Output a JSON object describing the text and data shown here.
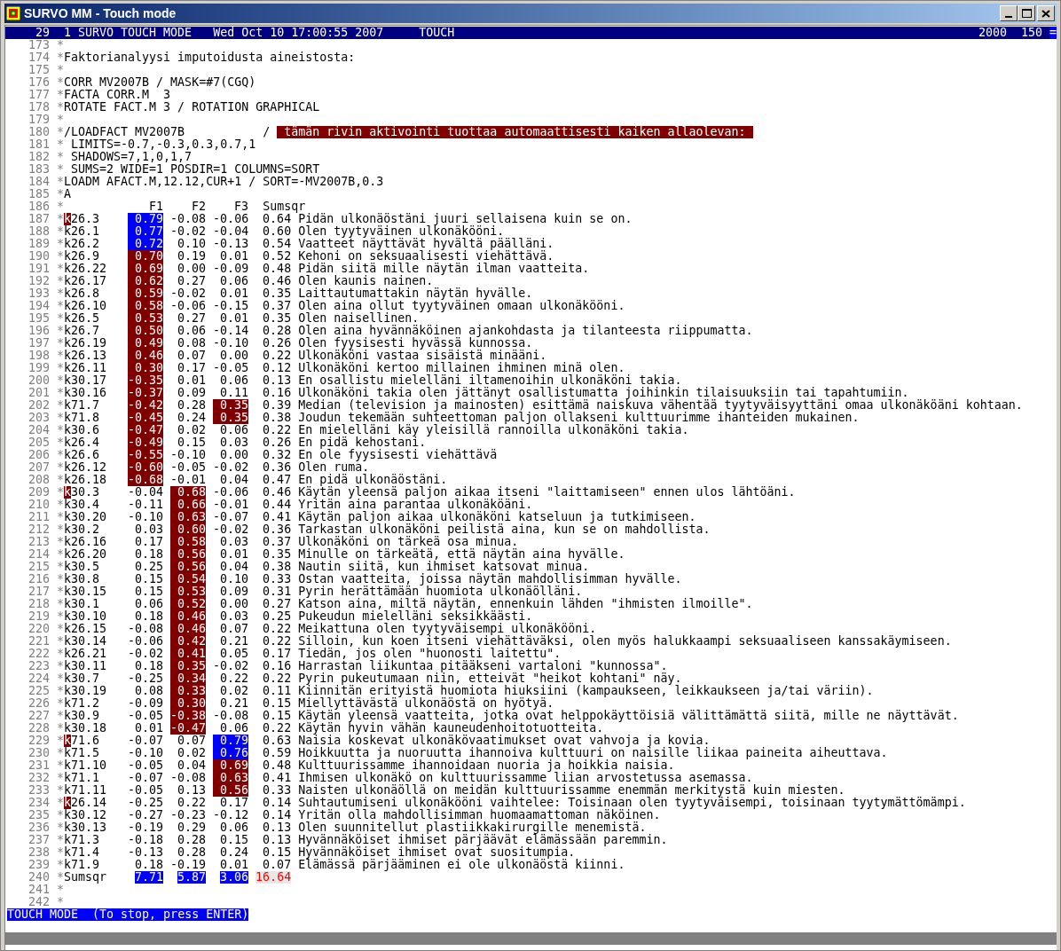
{
  "window": {
    "title": "SURVO MM - Touch mode"
  },
  "status_bar": {
    "number": "29",
    "mode": "1 SURVO TOUCH MODE",
    "datetime": "Wed Oct 10 17:00:55 2007",
    "mode_label": "TOUCH",
    "value_1": "2000",
    "value_2": "150",
    "end_mark": "="
  },
  "lines": [
    {
      "kind": "text",
      "num": "173",
      "control": "*"
    },
    {
      "kind": "text",
      "num": "174",
      "control": "*",
      "segments": [
        {
          "kind": "plain",
          "text": "Faktorianalyysi imputoidusta aineistosta:"
        }
      ]
    },
    {
      "kind": "text",
      "num": "175",
      "control": "*"
    },
    {
      "kind": "text",
      "num": "176",
      "control": "*",
      "segments": [
        {
          "kind": "plain",
          "text": "CORR MV2007B / MASK=#7(CGQ)"
        }
      ]
    },
    {
      "kind": "text",
      "num": "177",
      "control": "*",
      "segments": [
        {
          "kind": "plain",
          "text": "FACTA CORR.M  3"
        }
      ]
    },
    {
      "kind": "text",
      "num": "178",
      "control": "*",
      "segments": [
        {
          "kind": "plain",
          "text": "ROTATE FACT.M 3 / ROTATION GRAPHICAL"
        }
      ]
    },
    {
      "kind": "text",
      "num": "179",
      "control": "*"
    },
    {
      "kind": "text",
      "num": "180",
      "control": "*",
      "segments": [
        {
          "kind": "plain",
          "text": "/LOADFACT MV2007B           / "
        },
        {
          "kind": "banner",
          "text": " tämän rivin aktivointi tuottaa automaattisesti kaiken allaolevan: "
        }
      ]
    },
    {
      "kind": "text",
      "num": "181",
      "control": "*",
      "segments": [
        {
          "kind": "plain",
          "text": " LIMITS=-0.7,-0.3,0.3,0.7,1"
        }
      ]
    },
    {
      "kind": "text",
      "num": "182",
      "control": "*",
      "segments": [
        {
          "kind": "plain",
          "text": " SHADOWS=7,1,0,1,7"
        }
      ]
    },
    {
      "kind": "text",
      "num": "183",
      "control": "*",
      "segments": [
        {
          "kind": "plain",
          "text": " SUMS=2 WIDE=1 POSDIR=1 COLUMNS=SORT"
        }
      ]
    },
    {
      "kind": "text",
      "num": "184",
      "control": "*",
      "segments": [
        {
          "kind": "plain",
          "text": "LOADM AFACT.M,12.12,CUR+1 / SORT=-MV2007B,0.3"
        }
      ]
    },
    {
      "kind": "text",
      "num": "185",
      "control": "*",
      "segments": [
        {
          "kind": "plain",
          "text": "A"
        }
      ]
    },
    {
      "kind": "header",
      "num": "186",
      "control": "*",
      "columns": [
        "F1",
        "F2",
        "F3",
        "Sumsqr"
      ]
    },
    {
      "kind": "loading",
      "num": "187",
      "control": "*",
      "name": "k26.3",
      "cursor": true,
      "values": [
        {
          "text": "0.79",
          "color": "#0000ff"
        },
        {
          "text": "-0.08"
        },
        {
          "text": "-0.06"
        }
      ],
      "sumsqr": "0.64",
      "text": "Pidän ulkonäöstäni juuri sellaisena kuin se on."
    },
    {
      "kind": "loading",
      "num": "188",
      "control": "*",
      "name": "k26.1",
      "cursor": false,
      "values": [
        {
          "text": "0.77",
          "color": "#0000ff"
        },
        {
          "text": "-0.02"
        },
        {
          "text": "-0.04"
        }
      ],
      "sumsqr": "0.60",
      "text": "Olen tyytyväinen ulkonäkööni."
    },
    {
      "kind": "loading",
      "num": "189",
      "control": "*",
      "name": "k26.2",
      "cursor": false,
      "values": [
        {
          "text": "0.72",
          "color": "#0000ff"
        },
        {
          "text": "0.10"
        },
        {
          "text": "-0.13"
        }
      ],
      "sumsqr": "0.54",
      "text": "Vaatteet näyttävät hyvältä päälläni."
    },
    {
      "kind": "loading",
      "num": "190",
      "control": "*",
      "name": "k26.9",
      "cursor": false,
      "values": [
        {
          "text": "0.70",
          "color": "#800000"
        },
        {
          "text": "0.19"
        },
        {
          "text": "0.01"
        }
      ],
      "sumsqr": "0.52",
      "text": "Kehoni on seksuaalisesti viehättävä."
    },
    {
      "kind": "loading",
      "num": "191",
      "control": "*",
      "name": "k26.22",
      "cursor": false,
      "values": [
        {
          "text": "0.69",
          "color": "#800000"
        },
        {
          "text": "0.00"
        },
        {
          "text": "-0.09"
        }
      ],
      "sumsqr": "0.48",
      "text": "Pidän siitä mille näytän ilman vaatteita."
    },
    {
      "kind": "loading",
      "num": "192",
      "control": "*",
      "name": "k26.17",
      "cursor": false,
      "values": [
        {
          "text": "0.62",
          "color": "#800000"
        },
        {
          "text": "0.27"
        },
        {
          "text": "0.06"
        }
      ],
      "sumsqr": "0.46",
      "text": "Olen kaunis nainen."
    },
    {
      "kind": "loading",
      "num": "193",
      "control": "*",
      "name": "k26.8",
      "cursor": false,
      "values": [
        {
          "text": "0.59",
          "color": "#800000"
        },
        {
          "text": "-0.02"
        },
        {
          "text": "0.01"
        }
      ],
      "sumsqr": "0.35",
      "text": "Laittautumattakin näytän hyvälle."
    },
    {
      "kind": "loading",
      "num": "194",
      "control": "*",
      "name": "k26.10",
      "cursor": false,
      "values": [
        {
          "text": "0.58",
          "color": "#800000"
        },
        {
          "text": "-0.06"
        },
        {
          "text": "-0.15"
        }
      ],
      "sumsqr": "0.37",
      "text": "Olen aina ollut tyytyväinen omaan ulkonäkööni."
    },
    {
      "kind": "loading",
      "num": "195",
      "control": "*",
      "name": "k26.5",
      "cursor": false,
      "values": [
        {
          "text": "0.53",
          "color": "#800000"
        },
        {
          "text": "0.27"
        },
        {
          "text": "0.01"
        }
      ],
      "sumsqr": "0.35",
      "text": "Olen naisellinen."
    },
    {
      "kind": "loading",
      "num": "196",
      "control": "*",
      "name": "k26.7",
      "cursor": false,
      "values": [
        {
          "text": "0.50",
          "color": "#800000"
        },
        {
          "text": "0.06"
        },
        {
          "text": "-0.14"
        }
      ],
      "sumsqr": "0.28",
      "text": "Olen aina hyvännäköinen ajankohdasta ja tilanteesta riippumatta."
    },
    {
      "kind": "loading",
      "num": "197",
      "control": "*",
      "name": "k26.19",
      "cursor": false,
      "values": [
        {
          "text": "0.49",
          "color": "#800000"
        },
        {
          "text": "0.08"
        },
        {
          "text": "-0.10"
        }
      ],
      "sumsqr": "0.26",
      "text": "Olen fyysisesti hyvässä kunnossa."
    },
    {
      "kind": "loading",
      "num": "198",
      "control": "*",
      "name": "k26.13",
      "cursor": false,
      "values": [
        {
          "text": "0.46",
          "color": "#800000"
        },
        {
          "text": "0.07"
        },
        {
          "text": "0.00"
        }
      ],
      "sumsqr": "0.22",
      "text": "Ulkonäköni vastaa sisäistä minääni."
    },
    {
      "kind": "loading",
      "num": "199",
      "control": "*",
      "name": "k26.11",
      "cursor": false,
      "values": [
        {
          "text": "0.30",
          "color": "#800000"
        },
        {
          "text": "0.17"
        },
        {
          "text": "-0.05"
        }
      ],
      "sumsqr": "0.12",
      "text": "Ulkonäköni kertoo millainen ihminen minä olen."
    },
    {
      "kind": "loading",
      "num": "200",
      "control": "*",
      "name": "k30.17",
      "cursor": false,
      "values": [
        {
          "text": "-0.35",
          "color": "#800000"
        },
        {
          "text": "0.01"
        },
        {
          "text": "0.06"
        }
      ],
      "sumsqr": "0.13",
      "text": "En osallistu mielelläni iltamenoihin ulkonäköni takia."
    },
    {
      "kind": "loading",
      "num": "201",
      "control": "*",
      "name": "k30.16",
      "cursor": false,
      "values": [
        {
          "text": "-0.37",
          "color": "#800000"
        },
        {
          "text": "0.09"
        },
        {
          "text": "0.11"
        }
      ],
      "sumsqr": "0.16",
      "text": "Ulkonäköni takia olen jättänyt osallistumatta joihinkin tilaisuuksiin tai tapahtumiin."
    },
    {
      "kind": "loading",
      "num": "202",
      "control": "*",
      "name": "k71.7",
      "cursor": false,
      "values": [
        {
          "text": "-0.42",
          "color": "#800000"
        },
        {
          "text": "0.28"
        },
        {
          "text": "0.35",
          "color": "#800000"
        }
      ],
      "sumsqr": "0.39",
      "text": "Median (television ja mainosten) esittämä naiskuva vähentää tyytyväisyyttäni omaa ulkonäköäni kohtaan."
    },
    {
      "kind": "loading",
      "num": "203",
      "control": "*",
      "name": "k71.8",
      "cursor": false,
      "values": [
        {
          "text": "-0.45",
          "color": "#800000"
        },
        {
          "text": "0.24"
        },
        {
          "text": "0.35",
          "color": "#800000"
        }
      ],
      "sumsqr": "0.38",
      "text": "Joudun tekemään suhteettoman paljon ollakseni kulttuurimme ihanteiden mukainen."
    },
    {
      "kind": "loading",
      "num": "204",
      "control": "*",
      "name": "k30.6",
      "cursor": false,
      "values": [
        {
          "text": "-0.47",
          "color": "#800000"
        },
        {
          "text": "0.02"
        },
        {
          "text": "0.06"
        }
      ],
      "sumsqr": "0.22",
      "text": "En mielelläni käy yleisillä rannoilla ulkonäköni takia."
    },
    {
      "kind": "loading",
      "num": "205",
      "control": "*",
      "name": "k26.4",
      "cursor": false,
      "values": [
        {
          "text": "-0.49",
          "color": "#800000"
        },
        {
          "text": "0.15"
        },
        {
          "text": "0.03"
        }
      ],
      "sumsqr": "0.26",
      "text": "En pidä kehostani."
    },
    {
      "kind": "loading",
      "num": "206",
      "control": "*",
      "name": "k26.6",
      "cursor": false,
      "values": [
        {
          "text": "-0.55",
          "color": "#800000"
        },
        {
          "text": "-0.10"
        },
        {
          "text": "0.00"
        }
      ],
      "sumsqr": "0.32",
      "text": "En ole fyysisesti viehättävä"
    },
    {
      "kind": "loading",
      "num": "207",
      "control": "*",
      "name": "k26.12",
      "cursor": false,
      "values": [
        {
          "text": "-0.60",
          "color": "#800000"
        },
        {
          "text": "-0.05"
        },
        {
          "text": "-0.02"
        }
      ],
      "sumsqr": "0.36",
      "text": "Olen ruma."
    },
    {
      "kind": "loading",
      "num": "208",
      "control": "*",
      "name": "k26.18",
      "cursor": false,
      "values": [
        {
          "text": "-0.68",
          "color": "#800000"
        },
        {
          "text": "-0.01"
        },
        {
          "text": "0.04"
        }
      ],
      "sumsqr": "0.47",
      "text": "En pidä ulkonäöstäni."
    },
    {
      "kind": "loading",
      "num": "209",
      "control": "*",
      "name": "k30.3",
      "cursor": true,
      "values": [
        {
          "text": "-0.04"
        },
        {
          "text": "0.68",
          "color": "#800000"
        },
        {
          "text": "-0.06"
        }
      ],
      "sumsqr": "0.46",
      "text": "Käytän yleensä paljon aikaa itseni \"laittamiseen\" ennen ulos lähtöäni."
    },
    {
      "kind": "loading",
      "num": "210",
      "control": "*",
      "name": "k30.4",
      "cursor": false,
      "values": [
        {
          "text": "-0.11"
        },
        {
          "text": "0.66",
          "color": "#800000"
        },
        {
          "text": "-0.01"
        }
      ],
      "sumsqr": "0.44",
      "text": "Yritän aina parantaa ulkonäköäni."
    },
    {
      "kind": "loading",
      "num": "211",
      "control": "*",
      "name": "k30.20",
      "cursor": false,
      "values": [
        {
          "text": "-0.10"
        },
        {
          "text": "0.63",
          "color": "#800000"
        },
        {
          "text": "-0.07"
        }
      ],
      "sumsqr": "0.41",
      "text": "Käytän paljon aikaa ulkonäköni katseluun ja tutkimiseen."
    },
    {
      "kind": "loading",
      "num": "212",
      "control": "*",
      "name": "k30.2",
      "cursor": false,
      "values": [
        {
          "text": "0.03"
        },
        {
          "text": "0.60",
          "color": "#800000"
        },
        {
          "text": "-0.02"
        }
      ],
      "sumsqr": "0.36",
      "text": "Tarkastan ulkonäköni peilistä aina, kun se on mahdollista."
    },
    {
      "kind": "loading",
      "num": "213",
      "control": "*",
      "name": "k26.16",
      "cursor": false,
      "values": [
        {
          "text": "0.17"
        },
        {
          "text": "0.58",
          "color": "#800000"
        },
        {
          "text": "0.03"
        }
      ],
      "sumsqr": "0.37",
      "text": "Ulkonäköni on tärkeä osa minua."
    },
    {
      "kind": "loading",
      "num": "214",
      "control": "*",
      "name": "k26.20",
      "cursor": false,
      "values": [
        {
          "text": "0.18"
        },
        {
          "text": "0.56",
          "color": "#800000"
        },
        {
          "text": "0.01"
        }
      ],
      "sumsqr": "0.35",
      "text": "Minulle on tärkeätä, että näytän aina hyvälle."
    },
    {
      "kind": "loading",
      "num": "215",
      "control": "*",
      "name": "k30.5",
      "cursor": false,
      "values": [
        {
          "text": "0.25"
        },
        {
          "text": "0.56",
          "color": "#800000"
        },
        {
          "text": "0.04"
        }
      ],
      "sumsqr": "0.38",
      "text": "Nautin siitä, kun ihmiset katsovat minua."
    },
    {
      "kind": "loading",
      "num": "216",
      "control": "*",
      "name": "k30.8",
      "cursor": false,
      "values": [
        {
          "text": "0.15"
        },
        {
          "text": "0.54",
          "color": "#800000"
        },
        {
          "text": "0.10"
        }
      ],
      "sumsqr": "0.33",
      "text": "Ostan vaatteita, joissa näytän mahdollisimman hyvälle."
    },
    {
      "kind": "loading",
      "num": "217",
      "control": "*",
      "name": "k30.15",
      "cursor": false,
      "values": [
        {
          "text": "0.15"
        },
        {
          "text": "0.53",
          "color": "#800000"
        },
        {
          "text": "0.09"
        }
      ],
      "sumsqr": "0.31",
      "text": "Pyrin herättämään huomiota ulkonäölläni."
    },
    {
      "kind": "loading",
      "num": "218",
      "control": "*",
      "name": "k30.1",
      "cursor": false,
      "values": [
        {
          "text": "0.06"
        },
        {
          "text": "0.52",
          "color": "#800000"
        },
        {
          "text": "0.00"
        }
      ],
      "sumsqr": "0.27",
      "text": "Katson aina, miltä näytän, ennenkuin lähden \"ihmisten ilmoille\"."
    },
    {
      "kind": "loading",
      "num": "219",
      "control": "*",
      "name": "k30.10",
      "cursor": false,
      "values": [
        {
          "text": "0.18"
        },
        {
          "text": "0.46",
          "color": "#800000"
        },
        {
          "text": "0.03"
        }
      ],
      "sumsqr": "0.25",
      "text": "Pukeudun mielelläni seksikkäästi."
    },
    {
      "kind": "loading",
      "num": "220",
      "control": "*",
      "name": "k26.15",
      "cursor": false,
      "values": [
        {
          "text": "-0.08"
        },
        {
          "text": "0.46",
          "color": "#800000"
        },
        {
          "text": "0.07"
        }
      ],
      "sumsqr": "0.22",
      "text": "Meikattuna olen tyytyväisempi ulkonäkööni."
    },
    {
      "kind": "loading",
      "num": "221",
      "control": "*",
      "name": "k30.14",
      "cursor": false,
      "values": [
        {
          "text": "-0.06"
        },
        {
          "text": "0.42",
          "color": "#800000"
        },
        {
          "text": "0.21"
        }
      ],
      "sumsqr": "0.22",
      "text": "Silloin, kun koen itseni viehättäväksi, olen myös halukkaampi seksuaaliseen kanssakäymiseen."
    },
    {
      "kind": "loading",
      "num": "222",
      "control": "*",
      "name": "k26.21",
      "cursor": false,
      "values": [
        {
          "text": "-0.02"
        },
        {
          "text": "0.41",
          "color": "#800000"
        },
        {
          "text": "0.05"
        }
      ],
      "sumsqr": "0.17",
      "text": "Tiedän, jos olen \"huonosti laitettu\"."
    },
    {
      "kind": "loading",
      "num": "223",
      "control": "*",
      "name": "k30.11",
      "cursor": false,
      "values": [
        {
          "text": "0.18"
        },
        {
          "text": "0.35",
          "color": "#800000"
        },
        {
          "text": "-0.02"
        }
      ],
      "sumsqr": "0.16",
      "text": "Harrastan liikuntaa pitääkseni vartaloni \"kunnossa\"."
    },
    {
      "kind": "loading",
      "num": "224",
      "control": "*",
      "name": "k30.7",
      "cursor": false,
      "values": [
        {
          "text": "-0.25"
        },
        {
          "text": "0.34",
          "color": "#800000"
        },
        {
          "text": "0.22"
        }
      ],
      "sumsqr": "0.22",
      "text": "Pyrin pukeutumaan niin, etteivät \"heikot kohtani\" näy."
    },
    {
      "kind": "loading",
      "num": "225",
      "control": "*",
      "name": "k30.19",
      "cursor": false,
      "values": [
        {
          "text": "0.08"
        },
        {
          "text": "0.33",
          "color": "#800000"
        },
        {
          "text": "0.02"
        }
      ],
      "sumsqr": "0.11",
      "text": "Kiinnitän erityistä huomiota hiuksiini (kampaukseen, leikkaukseen ja/tai väriin)."
    },
    {
      "kind": "loading",
      "num": "226",
      "control": "*",
      "name": "k71.2",
      "cursor": false,
      "values": [
        {
          "text": "-0.09"
        },
        {
          "text": "0.30",
          "color": "#800000"
        },
        {
          "text": "0.21"
        }
      ],
      "sumsqr": "0.15",
      "text": "Miellyttävästä ulkonäöstä on hyötyä."
    },
    {
      "kind": "loading",
      "num": "227",
      "control": "*",
      "name": "k30.9",
      "cursor": false,
      "values": [
        {
          "text": "-0.05"
        },
        {
          "text": "-0.38",
          "color": "#800000"
        },
        {
          "text": "-0.08"
        }
      ],
      "sumsqr": "0.15",
      "text": "Käytän yleensä vaatteita, jotka ovat helppokäyttöisiä välittämättä siitä, mille ne näyttävät."
    },
    {
      "kind": "loading",
      "num": "228",
      "control": "*",
      "name": "k30.18",
      "cursor": false,
      "values": [
        {
          "text": "0.01"
        },
        {
          "text": "-0.47",
          "color": "#800000"
        },
        {
          "text": "0.06"
        }
      ],
      "sumsqr": "0.22",
      "text": "Käytän hyvin vähän kauneudenhoitotuotteita."
    },
    {
      "kind": "loading",
      "num": "229",
      "control": "*",
      "name": "k71.6",
      "cursor": true,
      "values": [
        {
          "text": "-0.07"
        },
        {
          "text": "0.07"
        },
        {
          "text": "0.79",
          "color": "#0000ff"
        }
      ],
      "sumsqr": "0.63",
      "text": "Naisia koskevat ulkonäkövaatimukset ovat vahvoja ja kovia."
    },
    {
      "kind": "loading",
      "num": "230",
      "control": "*",
      "name": "k71.5",
      "cursor": false,
      "values": [
        {
          "text": "-0.10"
        },
        {
          "text": "0.02"
        },
        {
          "text": "0.76",
          "color": "#0000ff"
        }
      ],
      "sumsqr": "0.59",
      "text": "Hoikkuutta ja nuoruutta ihannoiva kulttuuri on naisille liikaa paineita aiheuttava."
    },
    {
      "kind": "loading",
      "num": "231",
      "control": "*",
      "name": "k71.10",
      "cursor": false,
      "values": [
        {
          "text": "-0.05"
        },
        {
          "text": "0.04"
        },
        {
          "text": "0.69",
          "color": "#800000"
        }
      ],
      "sumsqr": "0.48",
      "text": "Kulttuurissamme ihannoidaan nuoria ja hoikkia naisia."
    },
    {
      "kind": "loading",
      "num": "232",
      "control": "*",
      "name": "k71.1",
      "cursor": false,
      "values": [
        {
          "text": "-0.07"
        },
        {
          "text": "-0.08"
        },
        {
          "text": "0.63",
          "color": "#800000"
        }
      ],
      "sumsqr": "0.41",
      "text": "Ihmisen ulkonäkö on kulttuurissamme liian arvostetussa asemassa."
    },
    {
      "kind": "loading",
      "num": "233",
      "control": "*",
      "name": "k71.11",
      "cursor": false,
      "values": [
        {
          "text": "-0.05"
        },
        {
          "text": "0.13"
        },
        {
          "text": "0.56",
          "color": "#800000"
        }
      ],
      "sumsqr": "0.33",
      "text": "Naisten ulkonäöllä on meidän kulttuurissamme enemmän merkitystä kuin miesten."
    },
    {
      "kind": "loading",
      "num": "234",
      "control": "*",
      "name": "k26.14",
      "cursor": true,
      "values": [
        {
          "text": "-0.25"
        },
        {
          "text": "0.22"
        },
        {
          "text": "0.17"
        }
      ],
      "sumsqr": "0.14",
      "text": "Suhtautumiseni ulkonäkööni vaihtelee: Toisinaan olen tyytyväisempi, toisinaan tyytymättömämpi."
    },
    {
      "kind": "loading",
      "num": "235",
      "control": "*",
      "name": "k30.12",
      "cursor": false,
      "values": [
        {
          "text": "-0.27"
        },
        {
          "text": "-0.23"
        },
        {
          "text": "-0.12"
        }
      ],
      "sumsqr": "0.14",
      "text": "Yritän olla mahdollisimman huomaamattoman näköinen."
    },
    {
      "kind": "loading",
      "num": "236",
      "control": "*",
      "name": "k30.13",
      "cursor": false,
      "values": [
        {
          "text": "-0.19"
        },
        {
          "text": "0.29"
        },
        {
          "text": "0.06"
        }
      ],
      "sumsqr": "0.13",
      "text": "Olen suunnitellut plastiikkakirurgille menemistä."
    },
    {
      "kind": "loading",
      "num": "237",
      "control": "*",
      "name": "k71.3",
      "cursor": false,
      "values": [
        {
          "text": "-0.18"
        },
        {
          "text": "0.28"
        },
        {
          "text": "0.15"
        }
      ],
      "sumsqr": "0.13",
      "text": "Hyvännäköiset ihmiset pärjäävät elämässään paremmin."
    },
    {
      "kind": "loading",
      "num": "238",
      "control": "*",
      "name": "k71.4",
      "cursor": false,
      "values": [
        {
          "text": "-0.13"
        },
        {
          "text": "0.28"
        },
        {
          "text": "0.24"
        }
      ],
      "sumsqr": "0.15",
      "text": "Hyvännäköiset ihmiset ovat suositumpia."
    },
    {
      "kind": "loading",
      "num": "239",
      "control": "*",
      "name": "k71.9",
      "cursor": false,
      "values": [
        {
          "text": "0.18"
        },
        {
          "text": "-0.19"
        },
        {
          "text": "0.01"
        }
      ],
      "sumsqr": "0.07",
      "text": "Elämässä pärjääminen ei ole ulkonäöstä kiinni."
    },
    {
      "kind": "sum",
      "num": "240",
      "control": "*",
      "label": "Sumsqr",
      "values": [
        {
          "text": "7.71",
          "color": "#0000ff"
        },
        {
          "text": "5.87",
          "color": "#0000ff"
        },
        {
          "text": "3.06",
          "color": "#0000ff"
        }
      ],
      "total": "16.64"
    },
    {
      "kind": "text",
      "num": "241",
      "control": "*"
    },
    {
      "kind": "text",
      "num": "242",
      "control": "*"
    }
  ],
  "prompt": "TOUCH MODE  (To stop, press ENTER)"
}
